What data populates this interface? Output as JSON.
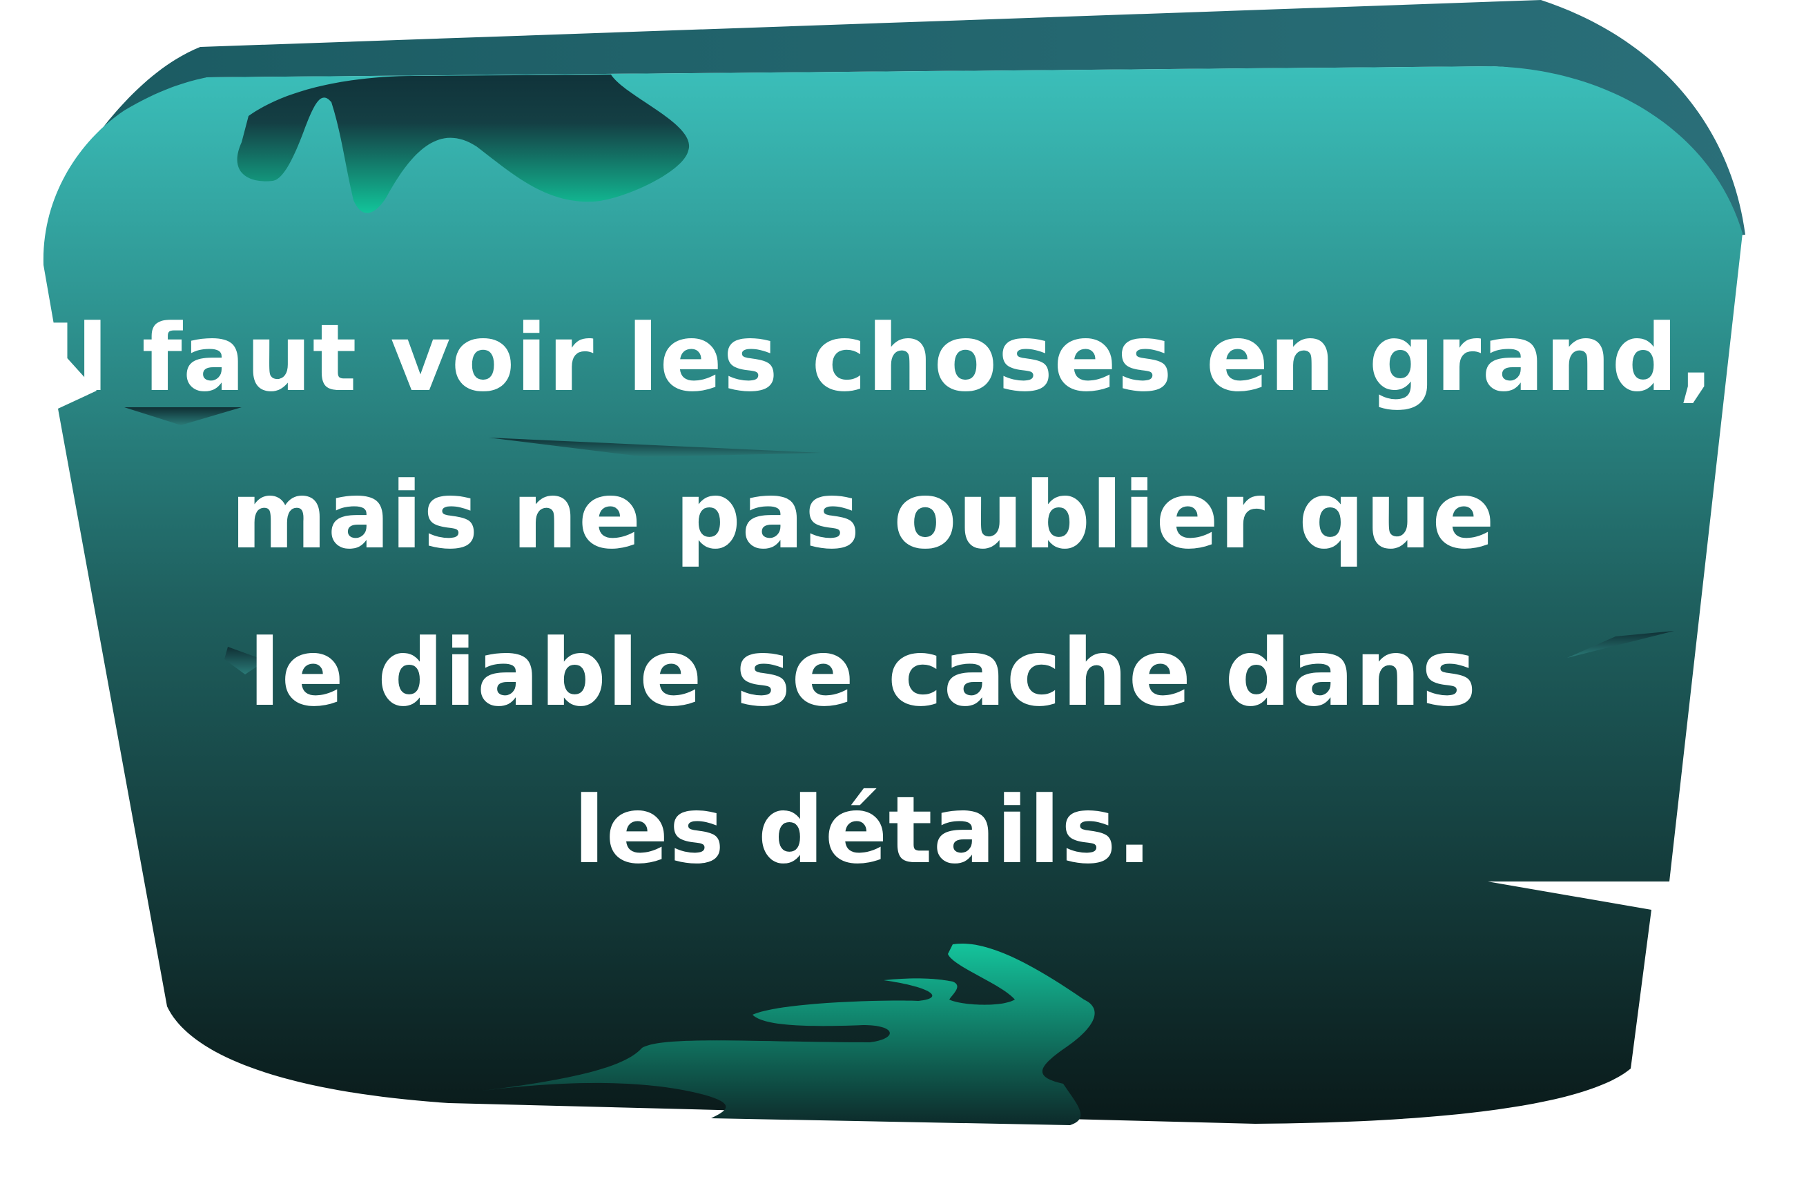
{
  "colors": {
    "board_top": "#3bbfba",
    "board_mid": "#1f5d5e",
    "board_bottom": "#0b1c1c",
    "edge_dark": "#143f47",
    "splash_green": "#13b890",
    "text": "#ffffff"
  },
  "sign": {
    "quote_lines": [
      "Il faut voir les choses en grand,",
      "mais ne pas oublier que",
      "le diable se cache dans",
      "les détails."
    ]
  }
}
